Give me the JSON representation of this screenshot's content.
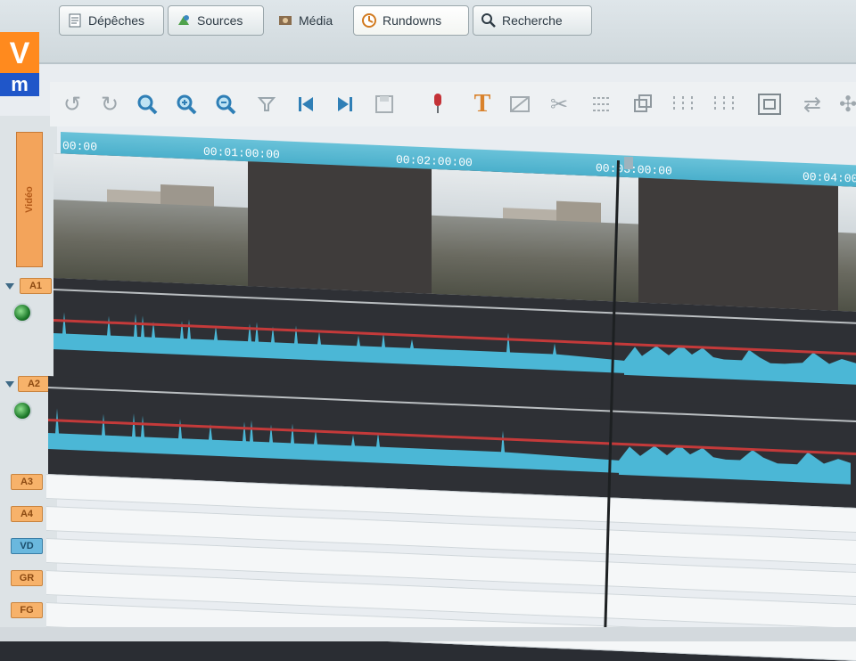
{
  "logo": {
    "top_text": "V",
    "bottom_text": "m"
  },
  "tabs": [
    {
      "label": "Dépêches",
      "icon": "document-icon"
    },
    {
      "label": "Sources",
      "icon": "sources-icon"
    },
    {
      "label": "Média",
      "icon": "media-icon"
    },
    {
      "label": "Rundowns",
      "icon": "rundown-icon"
    },
    {
      "label": "Recherche",
      "icon": "search-icon"
    }
  ],
  "toolbar": {
    "tools": [
      {
        "name": "undo-icon",
        "glyph": "↺"
      },
      {
        "name": "redo-icon",
        "glyph": "↻"
      },
      {
        "name": "zoom-icon",
        "glyph": "🔍"
      },
      {
        "name": "zoom-in-icon",
        "glyph": "⊕"
      },
      {
        "name": "zoom-out-icon",
        "glyph": "⊖"
      },
      {
        "name": "filter-icon",
        "glyph": "⏚"
      },
      {
        "name": "skip-back-icon",
        "glyph": "⏮"
      },
      {
        "name": "skip-forward-icon",
        "glyph": "⏭"
      },
      {
        "name": "save-icon",
        "glyph": "▣"
      },
      {
        "name": "microphone-icon",
        "glyph": "🎙"
      },
      {
        "name": "text-icon",
        "glyph": "T"
      },
      {
        "name": "effect-1-icon",
        "glyph": "▦"
      },
      {
        "name": "effect-2-icon",
        "glyph": "✂"
      },
      {
        "name": "effect-3-icon",
        "glyph": "▧"
      },
      {
        "name": "copy-icon",
        "glyph": "⧉"
      },
      {
        "name": "split-1-icon",
        "glyph": "⋮"
      },
      {
        "name": "split-2-icon",
        "glyph": "⋮"
      },
      {
        "name": "frame-icon",
        "glyph": "⬚"
      },
      {
        "name": "transition-icon",
        "glyph": "⇄"
      },
      {
        "name": "more-icon",
        "glyph": "✣"
      }
    ]
  },
  "timeline": {
    "labels": [
      "00:00",
      "00:01:00:00",
      "00:02:00:00",
      "00:03:00:00",
      "00:04:00"
    ],
    "video_label": "Vidéo",
    "tracks": [
      "A1",
      "A2",
      "A3",
      "A4",
      "VD",
      "GR",
      "FG"
    ]
  },
  "colors": {
    "ruler": "#3ea8c6",
    "audio_wave": "#4bb7d6",
    "gain_line": "#c43a3a",
    "logo_orange": "#ff8a1e",
    "logo_blue": "#1f56c9"
  }
}
